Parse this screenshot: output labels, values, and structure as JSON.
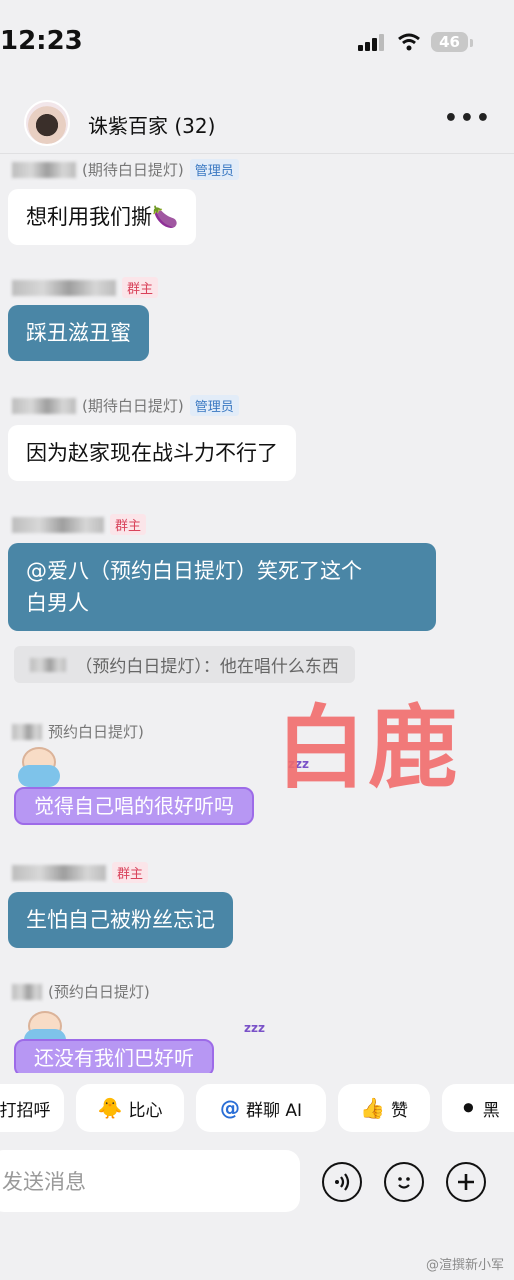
{
  "status_bar": {
    "time": "12:23",
    "battery": "46",
    "signal_icon": "signal-icon",
    "wifi_icon": "wifi-icon"
  },
  "header": {
    "title": "诛紫百家 (32)",
    "more_label": "•••"
  },
  "messages": [
    {
      "tag": "(期待白日提灯)",
      "role": "管理员",
      "text": "想利用我们撕🍆"
    },
    {
      "tag": "",
      "role": "群主",
      "text": "踩丑滋丑蜜"
    },
    {
      "tag": "(期待白日提灯)",
      "role": "管理员",
      "text": "因为赵家现在战斗力不行了"
    },
    {
      "tag": "",
      "role": "群主",
      "text_line1": "@爱八（预约白日提灯）笑死了这个",
      "text_line2": "白男人"
    },
    {
      "quote": "（预约白日提灯）：他在唱什么东西"
    },
    {
      "tag": "预约白日提灯)",
      "text": "觉得自己唱的很好听吗"
    },
    {
      "tag": "",
      "role": "群主",
      "text": "生怕自己被粉丝忘记"
    },
    {
      "tag": "(预约白日提灯)",
      "text": "还没有我们巴好听"
    }
  ],
  "watermark": "白鹿",
  "quick_chips": [
    {
      "label": "打招呼",
      "icon": ""
    },
    {
      "label": "比心",
      "icon": "🐥"
    },
    {
      "label": "群聊 AI",
      "icon": "@"
    },
    {
      "label": "赞",
      "icon": "👍"
    },
    {
      "label": "黑",
      "icon": "⚫"
    }
  ],
  "input": {
    "placeholder": "发送消息"
  },
  "credit": "@渲撰新小军"
}
